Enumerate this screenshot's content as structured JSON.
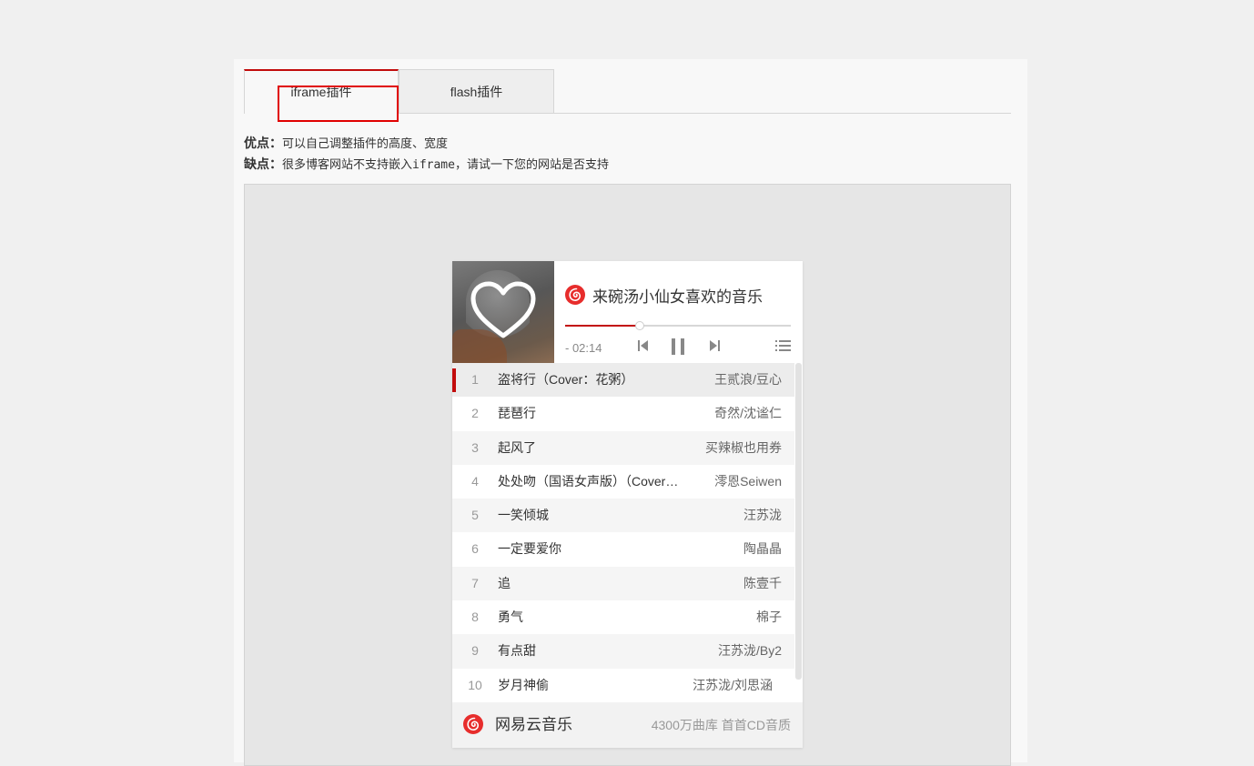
{
  "tabs": [
    {
      "label": "iframe插件"
    },
    {
      "label": "flash插件"
    }
  ],
  "description": {
    "pros_label": "优点：",
    "pros_text": "可以自己调整插件的高度、宽度",
    "cons_label": "缺点：",
    "cons_text": "很多博客网站不支持嵌入iframe，请试一下您的网站是否支持"
  },
  "player": {
    "playlist_title": "来碗汤小仙女喜欢的音乐",
    "time": "- 02:14",
    "progress": 0.33,
    "accent_color": "#c20c0c",
    "tracks": [
      {
        "num": "1",
        "song": "盗将行（Cover：花粥）",
        "artist": "王贰浪/豆心"
      },
      {
        "num": "2",
        "song": "琵琶行",
        "artist": "奇然/沈谧仁"
      },
      {
        "num": "3",
        "song": "起风了",
        "artist": "买辣椒也用券"
      },
      {
        "num": "4",
        "song": "处处吻（国语女声版）（Cover：杨千嬅）",
        "artist": "澪恩Seiwen"
      },
      {
        "num": "5",
        "song": "一笑倾城",
        "artist": "汪苏泷"
      },
      {
        "num": "6",
        "song": "一定要爱你",
        "artist": "陶晶晶"
      },
      {
        "num": "7",
        "song": "追",
        "artist": "陈壹千"
      },
      {
        "num": "8",
        "song": "勇气",
        "artist": "棉子"
      },
      {
        "num": "9",
        "song": "有点甜",
        "artist": "汪苏泷/By2"
      },
      {
        "num": "10",
        "song": "岁月神偷",
        "artist": "汪苏泷/刘思涵"
      }
    ],
    "footer_brand": "网易云音乐",
    "footer_slogan": "4300万曲库 首首CD音质"
  }
}
